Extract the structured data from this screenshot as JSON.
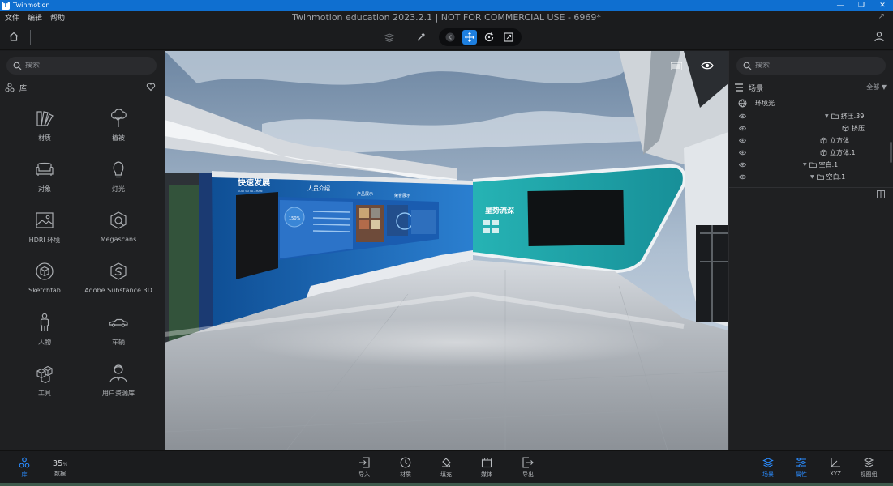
{
  "titlebar": {
    "app_name": "Twinmotion",
    "logo_letter": "T"
  },
  "menu": {
    "items": [
      "文件",
      "编辑",
      "帮助"
    ],
    "document_title": "Twinmotion education 2023.2.1 | NOT FOR COMMERCIAL USE - 6969*"
  },
  "left_panel": {
    "search_placeholder": "搜索",
    "header_label": "库",
    "items": [
      {
        "label": "材质",
        "icon": "swatch-icon"
      },
      {
        "label": "植被",
        "icon": "tree-icon"
      },
      {
        "label": "对象",
        "icon": "sofa-icon"
      },
      {
        "label": "灯光",
        "icon": "bulb-icon"
      },
      {
        "label": "HDRI 环境",
        "icon": "image-icon"
      },
      {
        "label": "Megascans",
        "icon": "megascans-icon"
      },
      {
        "label": "Sketchfab",
        "icon": "cube-icon"
      },
      {
        "label": "Adobe Substance 3D",
        "icon": "substance-icon"
      },
      {
        "label": "人物",
        "icon": "person-icon"
      },
      {
        "label": "车辆",
        "icon": "car-icon"
      },
      {
        "label": "工具",
        "icon": "cubes-icon"
      },
      {
        "label": "用户资源库",
        "icon": "user-library-icon"
      }
    ]
  },
  "right_panel": {
    "search_placeholder": "搜索",
    "header_label": "场景",
    "filter_label": "全部",
    "tree": [
      {
        "label": "环境光",
        "type": "globe",
        "indent": 0
      },
      {
        "label": "挤压.39",
        "type": "folder",
        "indent": 1,
        "expanded": true
      },
      {
        "label": "挤压...",
        "type": "cube",
        "indent": 2
      },
      {
        "label": "立方体",
        "type": "cube",
        "indent": 3
      },
      {
        "label": "立方体.1",
        "type": "cube",
        "indent": 3
      },
      {
        "label": "空白.1",
        "type": "folder",
        "indent": 4,
        "expanded": true
      },
      {
        "label": "空白.1",
        "type": "folder",
        "indent": 5,
        "expanded": true
      }
    ]
  },
  "viewport": {
    "wall_text": {
      "title_left": "快速发展",
      "subtitle_left": "KUAI SU FA ZHAN",
      "panel_people": "人员介绍",
      "panel_product": "产品展示",
      "panel_honor": "荣誉展示",
      "title_right": "星势流深",
      "stat_value": "150%"
    }
  },
  "bottom_bar": {
    "library_label": "库",
    "percent_value": "35",
    "percent_unit": "%",
    "data_label": "数据",
    "center_items": [
      {
        "label": "导入",
        "icon": "import-icon"
      },
      {
        "label": "材质",
        "icon": "clock-icon"
      },
      {
        "label": "填充",
        "icon": "fill-icon"
      },
      {
        "label": "媒体",
        "icon": "media-icon"
      },
      {
        "label": "导出",
        "icon": "export-icon"
      }
    ],
    "right_items": [
      {
        "label": "场景",
        "icon": "layers-icon",
        "active": true
      },
      {
        "label": "属性",
        "icon": "sliders-icon",
        "active": true
      },
      {
        "label": "XYZ",
        "icon": "axis-icon",
        "active": false
      },
      {
        "label": "视图组",
        "icon": "view-group-icon",
        "active": false
      }
    ]
  },
  "colors": {
    "accent": "#1d7fe0",
    "titlebar": "#0f6fd0",
    "panel": "#1f2022",
    "wall_blue": "#1a6fc0",
    "wall_teal": "#1aa3a8"
  }
}
